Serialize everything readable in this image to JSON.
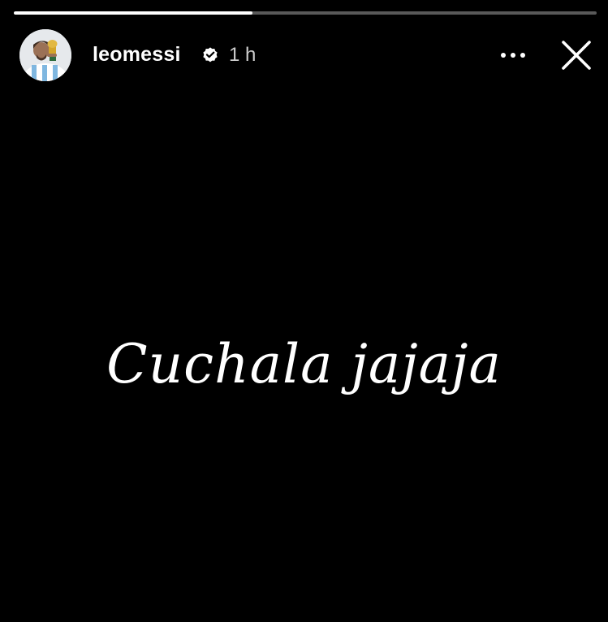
{
  "story": {
    "progress": 0.41,
    "username": "leomessi",
    "verified": true,
    "timestamp": "1 h",
    "text": "Cuchala jajaja"
  },
  "icons": {
    "verified": "verified-badge-icon",
    "more": "more-options-icon",
    "close": "close-icon"
  },
  "colors": {
    "background": "#000000",
    "text": "#ffffff",
    "progress_track": "#595959",
    "progress_fill": "#ffffff"
  }
}
